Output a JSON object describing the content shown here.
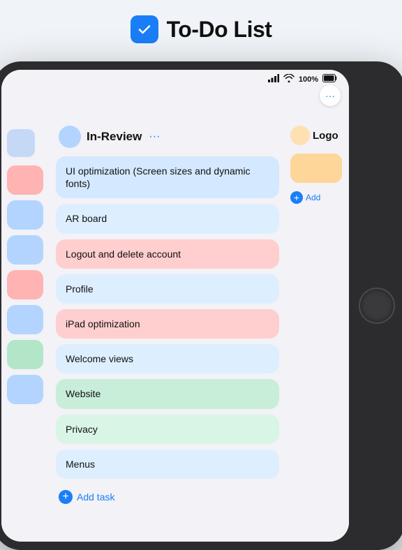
{
  "app": {
    "title": "To-Do List"
  },
  "status_bar": {
    "signal": "●●●●",
    "wifi": "WiFi",
    "battery_percent": "100%",
    "battery_icon": "🔋"
  },
  "dots_button": {
    "label": "···"
  },
  "columns": {
    "left": {
      "items": [
        {
          "color": "pink"
        },
        {
          "color": "blue"
        },
        {
          "color": "blue"
        },
        {
          "color": "pink"
        },
        {
          "color": "blue"
        },
        {
          "color": "green"
        },
        {
          "color": "blue"
        }
      ]
    },
    "middle": {
      "header": {
        "title": "In-Review",
        "dots": "···"
      },
      "tasks": [
        {
          "label": "UI optimization (Screen sizes and dynamic fonts)",
          "color": "blue"
        },
        {
          "label": "AR board",
          "color": "light-blue"
        },
        {
          "label": "Logout and delete account",
          "color": "pink"
        },
        {
          "label": "Profile",
          "color": "light-blue"
        },
        {
          "label": "iPad optimization",
          "color": "pink"
        },
        {
          "label": "Welcome views",
          "color": "light-blue"
        },
        {
          "label": "Website",
          "color": "green"
        },
        {
          "label": "Privacy",
          "color": "light-green"
        },
        {
          "label": "Menus",
          "color": "light-blue"
        }
      ],
      "add_task_label": "Add task"
    },
    "right": {
      "header": {
        "title": "Logo"
      },
      "tasks": [
        {
          "color": "orange"
        }
      ],
      "add_task_label": "Add"
    }
  }
}
